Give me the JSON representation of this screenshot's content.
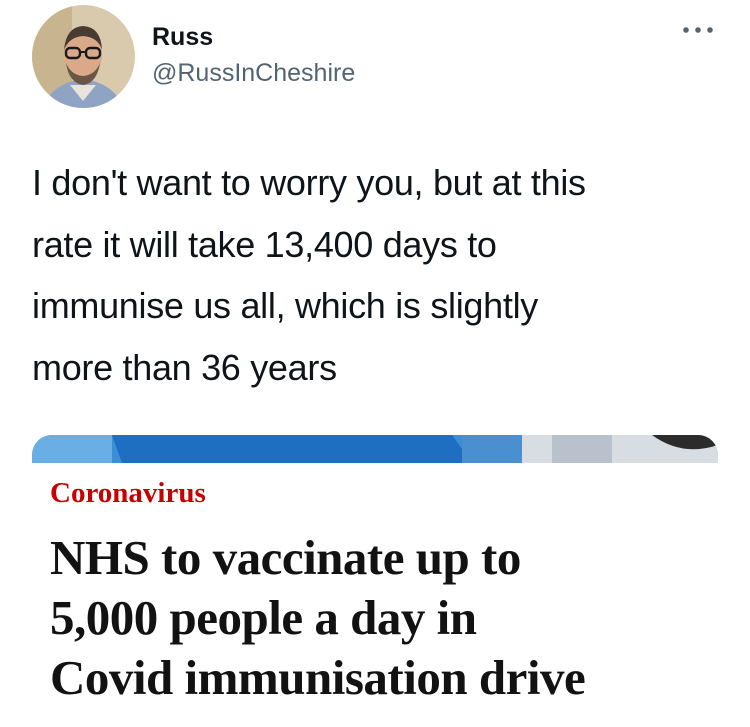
{
  "tweet": {
    "display_name": "Russ",
    "handle": "@RussInCheshire",
    "text": "I don't want to worry you, but at this\nrate it will take 13,400 days to\nimmunise us all, which is slightly\nmore than 36 years"
  },
  "icons": {
    "avatar": "avatar-photo",
    "more": "more-horizontal-icon"
  },
  "card": {
    "kicker": "Coronavirus",
    "headline": "NHS to vaccinate up to\n5,000 people a day in\nCovid immunisation drive"
  },
  "colors": {
    "kicker": "#c70000",
    "handle": "#536471",
    "text": "#0f1419"
  }
}
